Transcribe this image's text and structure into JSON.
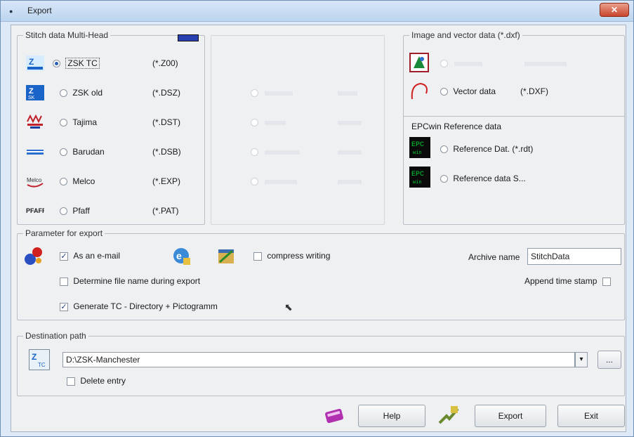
{
  "window": {
    "title": "Export",
    "close_label": "✕"
  },
  "stitch_group": {
    "label": "Stitch data Multi-Head",
    "items": [
      {
        "name": "ZSK TC",
        "ext": "(*.Z00)",
        "icon": "zsk-tc-icon"
      },
      {
        "name": "ZSK old",
        "ext": "(*.DSZ)",
        "icon": "zsk-old-icon"
      },
      {
        "name": "Tajima",
        "ext": "(*.DST)",
        "icon": "tajima-icon"
      },
      {
        "name": "Barudan",
        "ext": "(*.DSB)",
        "icon": "barudan-icon"
      },
      {
        "name": "Melco",
        "ext": "(*.EXP)",
        "icon": "melco-icon"
      },
      {
        "name": "Pfaff",
        "ext": "(*.PAT)",
        "icon": "pfaff-icon"
      }
    ]
  },
  "image_group": {
    "label": "Image and vector data (*.dxf)",
    "vector_label": "Vector data",
    "vector_ext": "(*.DXF)"
  },
  "epc_group": {
    "label": "EPCwin Reference data",
    "ref_dat_label": "Reference Dat. (*.rdt)",
    "ref_data_label": "Reference data S..."
  },
  "params": {
    "label": "Parameter for export",
    "as_email_label": "As an e-mail",
    "compress_label": "compress writing",
    "archive_name_label": "Archive name",
    "archive_name_value": "StitchData",
    "determine_label": "Determine file name during export",
    "append_label": "Append time stamp",
    "generate_label": "Generate TC - Directory + Pictogramm"
  },
  "destination": {
    "label": "Destination path",
    "path_value": "D:\\ZSK-Manchester",
    "browse_label": "...",
    "delete_label": "Delete entry"
  },
  "buttons": {
    "help": "Help",
    "export": "Export",
    "exit": "Exit"
  },
  "colors": {
    "titlebar": "#bcd4ee",
    "client": "#eef0f2",
    "epc_green": "#0c3"
  }
}
